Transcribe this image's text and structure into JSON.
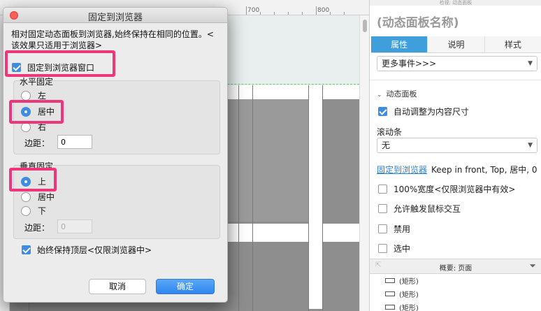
{
  "canvas": {
    "ruler_labels": [
      "700",
      "800"
    ]
  },
  "inspector": {
    "top_title": "检视: 动态面板",
    "panel_name": "(动态面板名称)",
    "tabs": [
      {
        "label": "属性",
        "active": true
      },
      {
        "label": "说明",
        "active": false
      },
      {
        "label": "样式",
        "active": false
      }
    ],
    "more_events": "更多事件>>>",
    "section_title": "动态面板",
    "auto_resize": {
      "label": "自动调整为内容尺寸",
      "checked": true
    },
    "scrollbar_label": "滚动条",
    "scrollbar_value": "无",
    "pin_link": "固定到浏览器",
    "pin_summary": "Keep in front, Top, 居中, 0",
    "checks": [
      {
        "label": "100%宽度<仅限浏览器中有效>",
        "checked": false
      },
      {
        "label": "允许触发鼠标交互",
        "checked": false
      },
      {
        "label": "禁用",
        "checked": false
      },
      {
        "label": "选中",
        "checked": false
      }
    ],
    "outline_title": "概要: 页面",
    "outline_items": [
      "(矩形)",
      "(矩形)",
      "(矩形)"
    ]
  },
  "dialog": {
    "title": "固定到浏览器",
    "description": "相对固定动态面板到浏览器,始终保持在相同的位置。<该效果只适用于浏览器>",
    "pin_checkbox": {
      "label": "固定到浏览器窗口",
      "checked": true
    },
    "horizontal": {
      "title": "水平固定",
      "options": [
        {
          "label": "左",
          "checked": false
        },
        {
          "label": "居中",
          "checked": true
        },
        {
          "label": "右",
          "checked": false
        }
      ],
      "margin_label": "边距：",
      "margin_value": "0"
    },
    "vertical": {
      "title": "垂直固定",
      "options": [
        {
          "label": "上",
          "checked": true
        },
        {
          "label": "居中",
          "checked": false
        },
        {
          "label": "下",
          "checked": false
        }
      ],
      "margin_label": "边距：",
      "margin_value": "0"
    },
    "keep_front": {
      "label": "始终保持顶层<仅限浏览器中>",
      "checked": true
    },
    "cancel_label": "取消",
    "ok_label": "确定"
  },
  "colors": {
    "accent": "#3d8de3",
    "annotation": "#f0367a",
    "tab_active": "#3f9fdc"
  }
}
